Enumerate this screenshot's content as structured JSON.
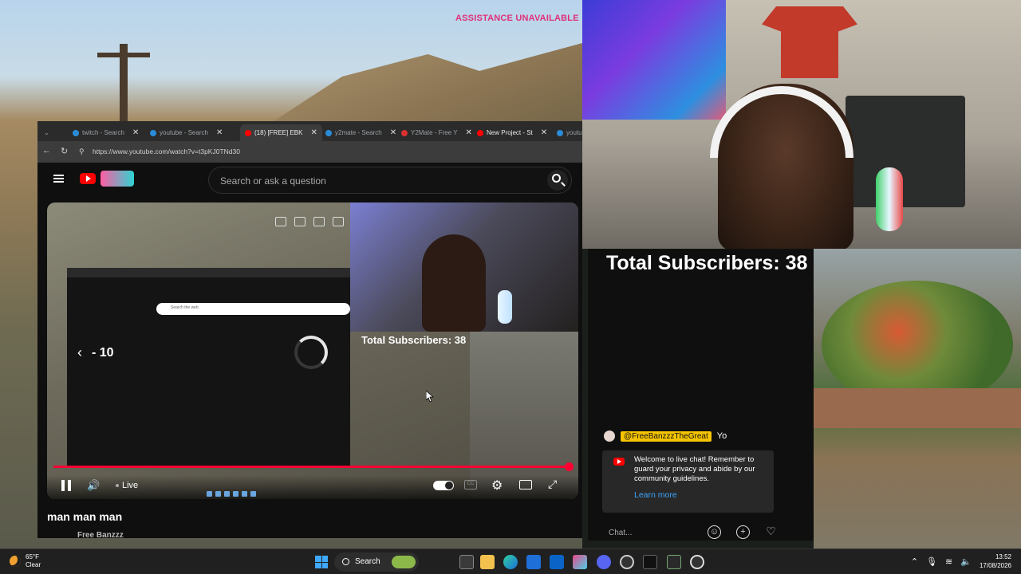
{
  "overlay": {
    "assistance_text": "ASSISTANCE UNAVAILABLE",
    "total_subscribers": "Total Subscribers: 38"
  },
  "browser": {
    "tabs": [
      {
        "label": "twitch - Search",
        "icon": "bing-icon"
      },
      {
        "label": "youtube - Search",
        "icon": "bing-icon"
      },
      {
        "label": "(18) [FREE] EBK",
        "icon": "youtube-icon",
        "active": true
      },
      {
        "label": "y2mate - Search",
        "icon": "bing-icon"
      },
      {
        "label": "Y2Mate - Free Y",
        "icon": "y2mate-icon"
      },
      {
        "label": "New Project - St",
        "icon": "youtube-icon"
      },
      {
        "label": "youtu",
        "icon": "bing-icon"
      }
    ],
    "url": "https://www.youtube.com/watch?v=t3pKJ0TNd30"
  },
  "youtube": {
    "search_placeholder": "Search or ask a question",
    "video_title": "man man man",
    "channel_name": "Free Banzzz",
    "player": {
      "rewind_label": "- 10",
      "live_label": "Live",
      "overlay_subscribers": "Total Subscribers: 38",
      "inner_search_placeholder": "Search the web",
      "progress_fraction": 1.0
    }
  },
  "chat": {
    "message": {
      "author": "@FreeBanzzzTheGreat",
      "text": "Yo"
    },
    "welcome_text": "Welcome to live chat! Remember to guard your privacy and abide by our community guidelines.",
    "learn_more": "Learn more",
    "input_placeholder": "Chat..."
  },
  "taskbar": {
    "weather_temp": "65°F",
    "weather_cond": "Clear",
    "search_label": "Search",
    "time": "13:52",
    "date": "17/08/2026"
  },
  "colors": {
    "youtube_red": "#ff0000",
    "assist_pink": "#e0307a",
    "chat_name_bg": "#f5c400",
    "link_blue": "#3ea6ff"
  }
}
